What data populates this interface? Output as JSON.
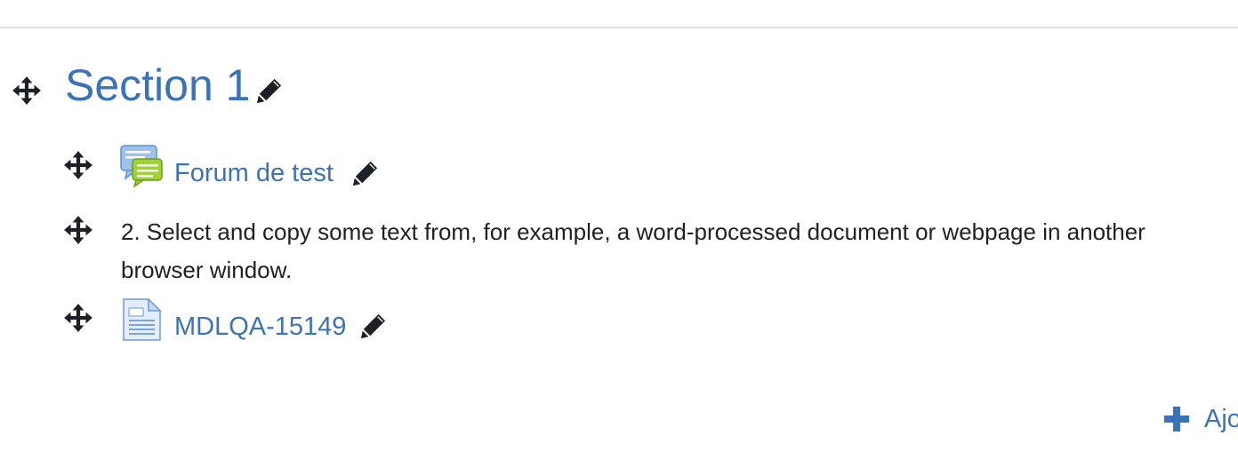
{
  "section": {
    "title": "Section 1"
  },
  "activities": [
    {
      "type": "forum",
      "label": "Forum de test",
      "icon": "forum-icon"
    },
    {
      "type": "label",
      "text": "2. Select and copy some text from, for example, a word-processed document or webpage in another browser window."
    },
    {
      "type": "resource",
      "label": "MDLQA-15149",
      "icon": "file-icon"
    }
  ],
  "add_activity": {
    "label": "Ajo"
  },
  "colors": {
    "link": "#3b73b9",
    "text": "#1d2125",
    "icon": "#1d2125"
  }
}
